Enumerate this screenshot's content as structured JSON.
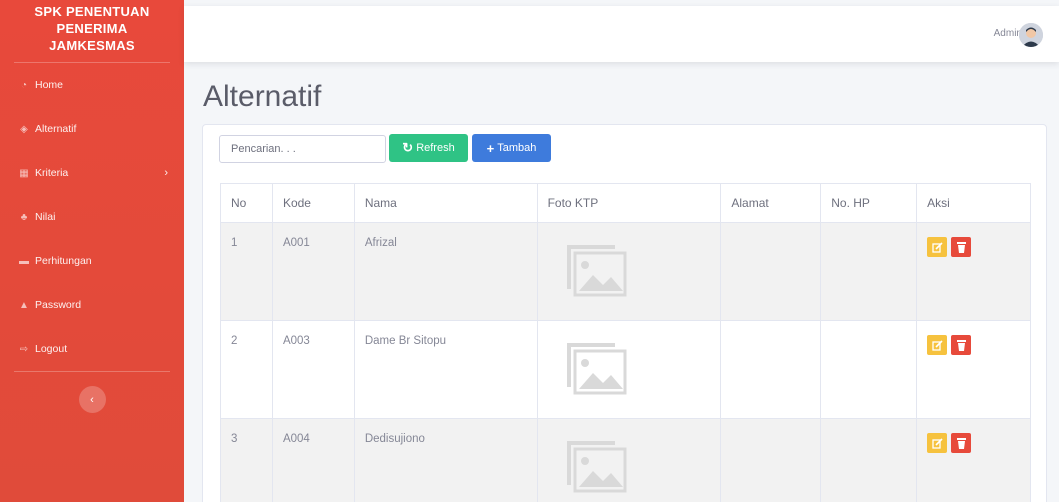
{
  "sidebar": {
    "brand": [
      "SPK PENENTUAN",
      "PENERIMA",
      "JAMKESMAS"
    ],
    "items": [
      {
        "label": "Home",
        "icon": "dashboard-icon"
      },
      {
        "label": "Alternatif",
        "icon": "cube-icon"
      },
      {
        "label": "Kriteria",
        "icon": "table-icon"
      },
      {
        "label": "Nilai",
        "icon": "chart-icon"
      },
      {
        "label": "Perhitungan",
        "icon": "calculator-icon"
      },
      {
        "label": "Password",
        "icon": "lock-icon"
      },
      {
        "label": "Logout",
        "icon": "logout-icon"
      }
    ],
    "kriteria_chevron": "›",
    "toggle_glyph": "‹"
  },
  "topbar": {
    "user_name": "Admin"
  },
  "page": {
    "title": "Alternatif"
  },
  "toolbar": {
    "search_placeholder": "Pencarian. . .",
    "refresh_label": "Refresh",
    "add_label": "Tambah"
  },
  "table": {
    "headers": [
      "No",
      "Kode",
      "Nama",
      "Foto KTP",
      "Alamat",
      "No. HP",
      "Aksi"
    ],
    "rows": [
      {
        "no": "1",
        "kode": "A001",
        "nama": "Afrizal",
        "alamat": "",
        "hp": ""
      },
      {
        "no": "2",
        "kode": "A003",
        "nama": "Dame Br Sitopu",
        "alamat": "",
        "hp": ""
      },
      {
        "no": "3",
        "kode": "A004",
        "nama": "Dedisujiono",
        "alamat": "",
        "hp": ""
      }
    ]
  },
  "colors": {
    "sidebar": "#e8493b",
    "refresh": "#2fc385",
    "add": "#3e7bdc",
    "edit": "#f6c23e",
    "delete": "#e74a3b"
  }
}
